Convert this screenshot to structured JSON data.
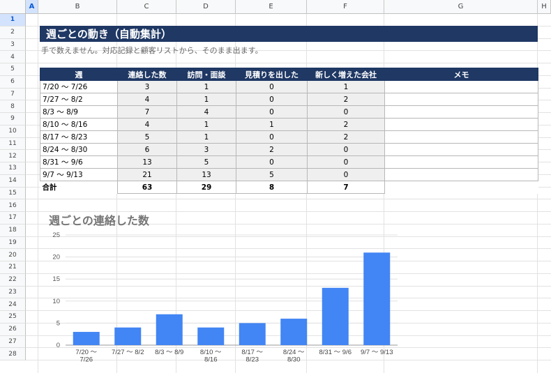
{
  "sheet": {
    "columns": [
      "A",
      "B",
      "C",
      "D",
      "E",
      "F",
      "G",
      "H"
    ],
    "selected_column": "A",
    "rows": [
      "1",
      "2",
      "3",
      "4",
      "5",
      "6",
      "7",
      "8",
      "9",
      "10",
      "11",
      "12",
      "13",
      "14",
      "15",
      "16",
      "17",
      "18",
      "19",
      "20",
      "21",
      "22",
      "23",
      "24",
      "25",
      "26",
      "27",
      "28"
    ],
    "selected_row": "1"
  },
  "title": "週ごとの動き（自動集計）",
  "subtitle": "手で数えません。対応記録と顧客リストから、そのまま出ます。",
  "table": {
    "headers": [
      "週",
      "連絡した数",
      "訪問・面談",
      "見積りを出した",
      "新しく増えた会社",
      "メモ"
    ],
    "rows": [
      {
        "week": "7/20 〜 7/26",
        "contacts": "3",
        "visits": "1",
        "quotes": "0",
        "new_companies": "1",
        "memo": ""
      },
      {
        "week": "7/27 〜 8/2",
        "contacts": "4",
        "visits": "1",
        "quotes": "0",
        "new_companies": "2",
        "memo": ""
      },
      {
        "week": "8/3 〜 8/9",
        "contacts": "7",
        "visits": "4",
        "quotes": "0",
        "new_companies": "0",
        "memo": ""
      },
      {
        "week": "8/10 〜 8/16",
        "contacts": "4",
        "visits": "1",
        "quotes": "1",
        "new_companies": "2",
        "memo": ""
      },
      {
        "week": "8/17 〜 8/23",
        "contacts": "5",
        "visits": "1",
        "quotes": "0",
        "new_companies": "2",
        "memo": ""
      },
      {
        "week": "8/24 〜 8/30",
        "contacts": "6",
        "visits": "3",
        "quotes": "2",
        "new_companies": "0",
        "memo": ""
      },
      {
        "week": "8/31 〜 9/6",
        "contacts": "13",
        "visits": "5",
        "quotes": "0",
        "new_companies": "0",
        "memo": ""
      },
      {
        "week": "9/7 〜 9/13",
        "contacts": "21",
        "visits": "13",
        "quotes": "5",
        "new_companies": "0",
        "memo": ""
      }
    ],
    "total": {
      "label": "合計",
      "contacts": "63",
      "visits": "29",
      "quotes": "8",
      "new_companies": "7"
    }
  },
  "colors": {
    "header_bg": "#1f3864",
    "bar": "#4285f4",
    "num_cell_bg": "#efefef"
  },
  "chart_data": {
    "type": "bar",
    "title": "週ごとの連絡した数",
    "categories": [
      [
        "7/20 〜",
        "7/26"
      ],
      [
        "7/27 〜 8/2"
      ],
      [
        "8/3 〜 8/9"
      ],
      [
        "8/10 〜",
        "8/16"
      ],
      [
        "8/17 〜",
        "8/23"
      ],
      [
        "8/24 〜",
        "8/30"
      ],
      [
        "8/31 〜 9/6"
      ],
      [
        "9/7 〜 9/13"
      ]
    ],
    "values": [
      3,
      4,
      7,
      4,
      5,
      6,
      13,
      21
    ],
    "ylim": [
      0,
      25
    ],
    "yticks": [
      "0",
      "5",
      "10",
      "15",
      "20",
      "25"
    ],
    "grid": true,
    "legend": "none"
  }
}
